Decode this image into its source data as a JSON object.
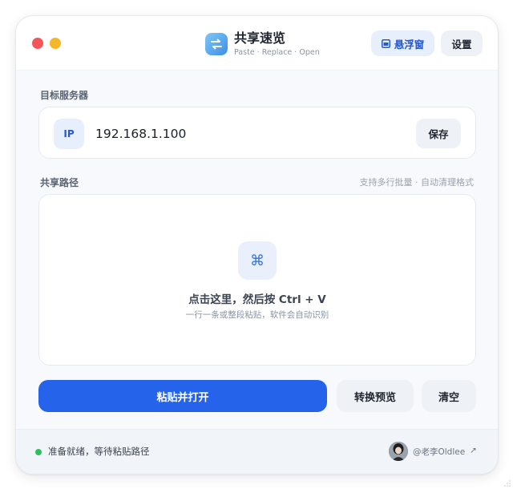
{
  "header": {
    "title": "共享速览",
    "subtitle": "Paste · Replace · Open",
    "float_button": "悬浮窗",
    "settings_button": "设置"
  },
  "server": {
    "label": "目标服务器",
    "badge": "IP",
    "value": "192.168.1.100",
    "save_button": "保存"
  },
  "share_path": {
    "label": "共享路径",
    "hint": "支持多行批量 · 自动清理格式",
    "icon_glyph": "⌘",
    "title": "点击这里，然后按 Ctrl + V",
    "subtitle": "一行一条或整段粘贴，软件会自动识别"
  },
  "actions": {
    "primary": "粘贴并打开",
    "convert": "转换预览",
    "clear": "清空"
  },
  "footer": {
    "status": "准备就绪，等待粘贴路径",
    "author": "@老李Oldlee",
    "link_glyph": "↗"
  },
  "colors": {
    "accent": "#2563eb",
    "status_ok": "#2ebf5f",
    "close": "#f2555a",
    "minimize": "#f5b72a"
  }
}
